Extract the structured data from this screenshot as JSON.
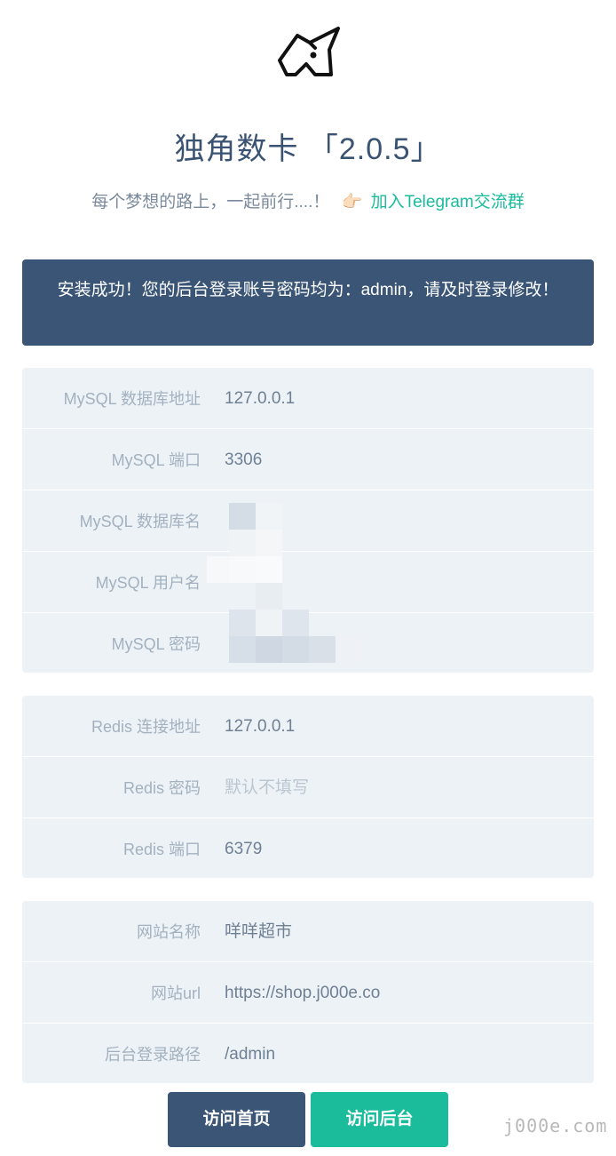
{
  "header": {
    "logo_icon": "unicorn-icon",
    "title": "独角数卡 「2.0.5」",
    "subtitle": "每个梦想的路上，一起前行....！",
    "hand_icon": "👉🏻",
    "telegram_link": "加入Telegram交流群"
  },
  "alert": {
    "message": "安装成功！您的后台登录账号密码均为：admin，请及时登录修改！"
  },
  "mysql": {
    "rows": [
      {
        "label": "MySQL 数据库地址",
        "value": "127.0.0.1"
      },
      {
        "label": "MySQL 端口",
        "value": "3306"
      },
      {
        "label": "MySQL 数据库名",
        "value": ""
      },
      {
        "label": "MySQL 用户名",
        "value": ""
      },
      {
        "label": "MySQL 密码",
        "value": ""
      }
    ]
  },
  "redis": {
    "rows": [
      {
        "label": "Redis 连接地址",
        "value": "127.0.0.1"
      },
      {
        "label": "Redis 密码",
        "value": "",
        "placeholder": "默认不填写"
      },
      {
        "label": "Redis 端口",
        "value": "6379"
      }
    ]
  },
  "site": {
    "rows": [
      {
        "label": "网站名称",
        "value": "咩咩超市"
      },
      {
        "label": "网站url",
        "value": "https://shop.j000e.co"
      },
      {
        "label": "后台登录路径",
        "value": "/admin"
      }
    ]
  },
  "buttons": {
    "home": "访问首页",
    "admin": "访问后台"
  },
  "watermark": "j000e.com",
  "colors": {
    "primary": "#3b5576",
    "accent": "#1abc9c",
    "card_bg": "#edf2f7"
  }
}
